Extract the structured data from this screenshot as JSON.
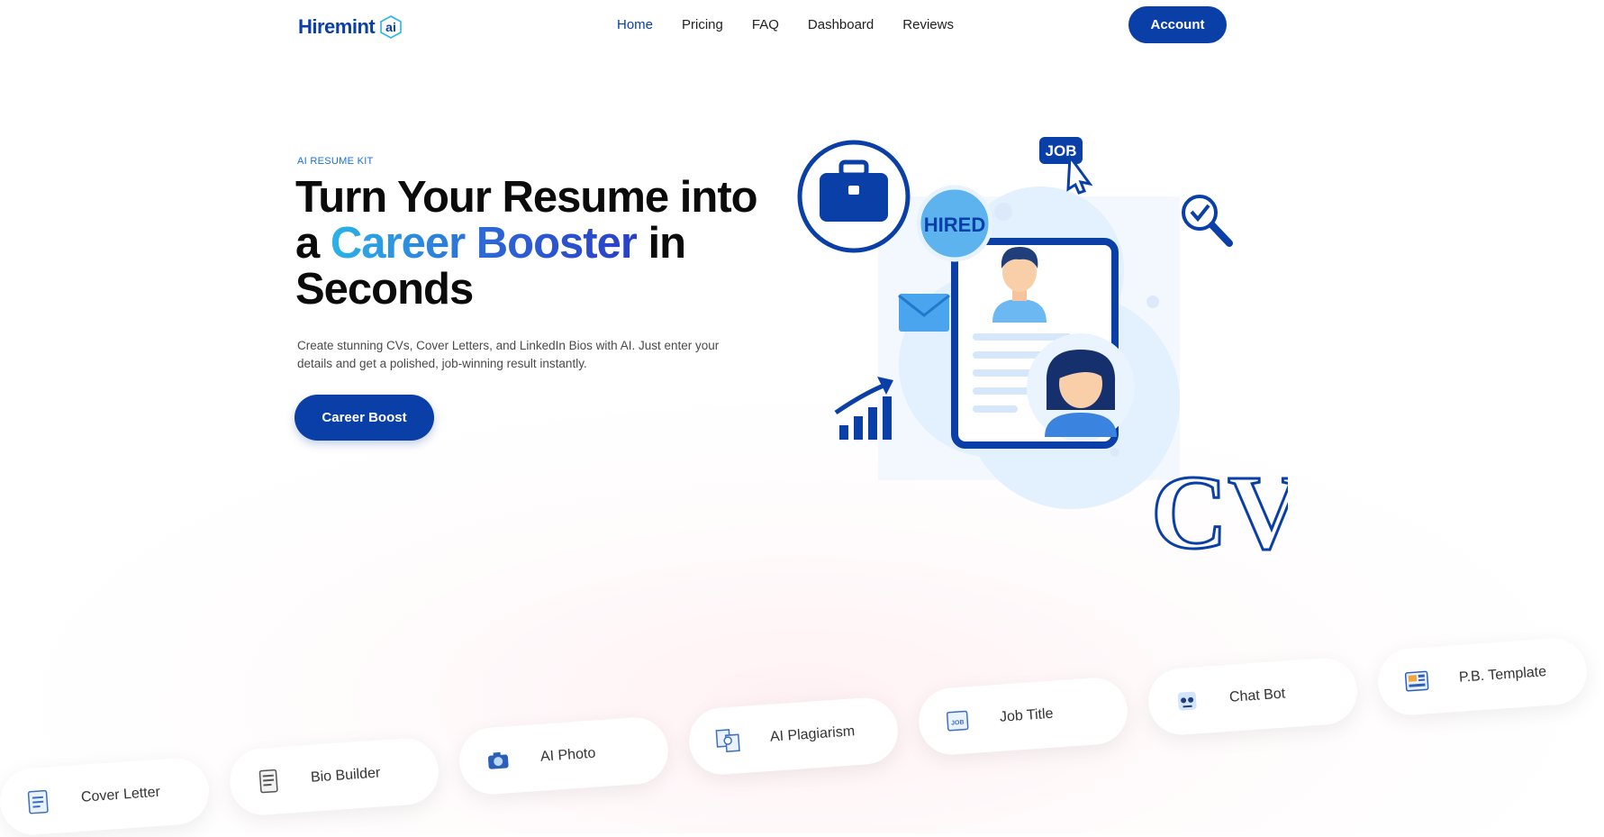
{
  "brand": {
    "name": "Hiremint",
    "suffix": "ai"
  },
  "nav": {
    "items": [
      {
        "label": "Home",
        "active": true
      },
      {
        "label": "Pricing",
        "active": false
      },
      {
        "label": "FAQ",
        "active": false
      },
      {
        "label": "Dashboard",
        "active": false
      },
      {
        "label": "Reviews",
        "active": false
      }
    ],
    "account_label": "Account"
  },
  "hero": {
    "eyebrow": "AI RESUME KIT",
    "title_part1": "Turn Your Resume into a ",
    "title_highlight": "Career Booster",
    "title_part2": " in Seconds",
    "description": "Create stunning CVs, Cover Letters, and LinkedIn Bios with AI. Just enter your details and get a polished, job-winning result instantly.",
    "cta_label": "Career Boost"
  },
  "illustration": {
    "hired_label": "HIRED",
    "job_label": "JOB",
    "cv_label": "CV"
  },
  "features": [
    {
      "label": "Cover Letter",
      "icon": "cover-letter-icon"
    },
    {
      "label": "Bio Builder",
      "icon": "bio-builder-icon"
    },
    {
      "label": "AI Photo",
      "icon": "camera-icon"
    },
    {
      "label": "AI Plagiarism",
      "icon": "plagiarism-icon"
    },
    {
      "label": "Job Title",
      "icon": "job-title-icon"
    },
    {
      "label": "Chat Bot",
      "icon": "chat-bot-icon"
    },
    {
      "label": "P.B. Template",
      "icon": "template-icon"
    }
  ],
  "colors": {
    "brand_blue": "#0a3fa8",
    "accent_light_blue": "#2bb3e8",
    "eyebrow_blue": "#1a6fd6"
  }
}
